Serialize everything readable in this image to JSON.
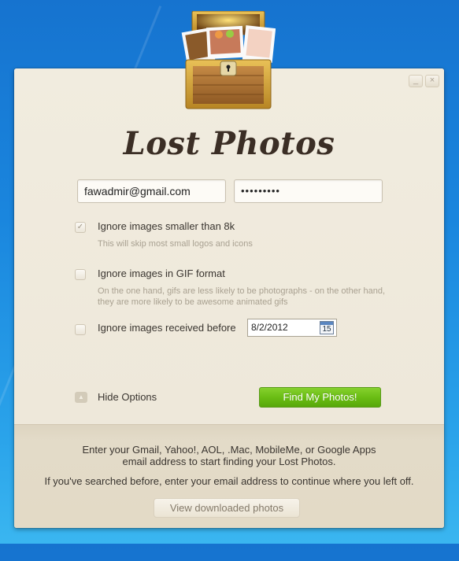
{
  "app": {
    "title": "Lost Photos",
    "window_controls": {
      "minimize": "_",
      "close": "×"
    }
  },
  "form": {
    "email_value": "fawadmir@gmail.com",
    "password_value": "•••••••••"
  },
  "options": [
    {
      "label": "Ignore images smaller than 8k",
      "hint": "This will skip most small logos and icons",
      "checked": true
    },
    {
      "label": "Ignore images in GIF format",
      "hint": "On the one hand, gifs are less likely to be photographs - on the other hand, they are more likely to be awesome animated gifs",
      "checked": false
    },
    {
      "label": "Ignore images received before",
      "hint": "",
      "checked": false,
      "date_value": "8/2/2012"
    }
  ],
  "calendar_icon_day": "15",
  "check_glyph": "✓",
  "toggle": {
    "label": "Hide Options",
    "icon": "▲"
  },
  "find_button": "Find My Photos!",
  "info": {
    "line1": "Enter your Gmail, Yahoo!, AOL, .Mac, MobileMe, or Google Apps",
    "line2": "email address to start finding your Lost Photos.",
    "line3": "If you've searched before, enter your email address to continue where you left off."
  },
  "view_button": "View downloaded photos",
  "colors": {
    "accent_green": "#6abd14",
    "title_brown": "#3b2e25",
    "desktop_blue": "#1a86de"
  }
}
